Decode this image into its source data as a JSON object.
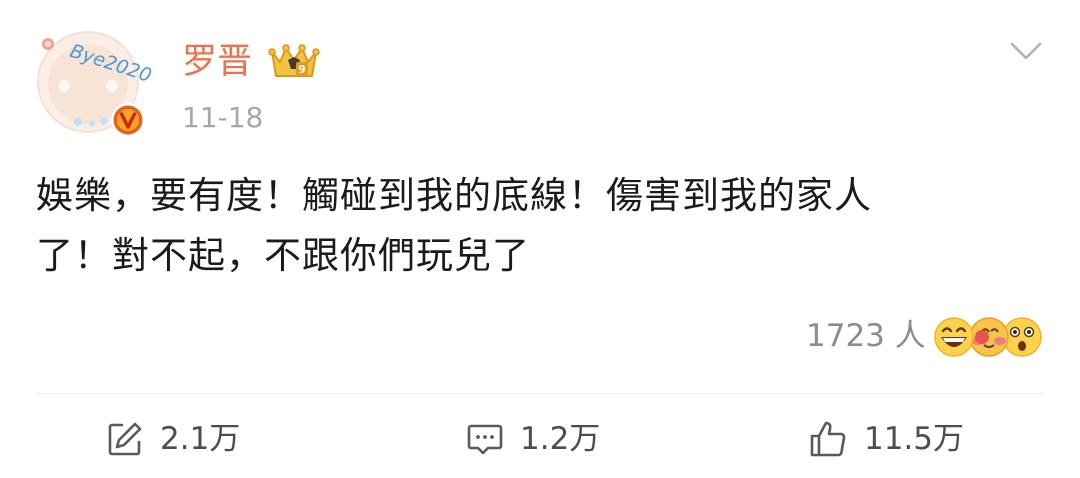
{
  "post": {
    "author": {
      "name": "罗晋",
      "avatar_badge": "Bye2020",
      "verified_icon": "verified-v-icon",
      "crown_icon": "crown-badge-icon"
    },
    "date": "11-18",
    "text_lines": [
      "娛樂，要有度！觸碰到我的底線！傷害到我的家人",
      "了！對不起，不跟你們玩兒了"
    ],
    "menu_icon": "chevron-down-icon",
    "reactions": {
      "count": "1723 人",
      "emoji_icons": [
        "laughing-emoji-icon",
        "cute-emoji-icon",
        "shocked-emoji-icon"
      ]
    }
  },
  "actions": {
    "repost": {
      "icon": "repost-icon",
      "count": "2.1万"
    },
    "comment": {
      "icon": "comment-icon",
      "count": "1.2万"
    },
    "like": {
      "icon": "like-icon",
      "count": "11.5万"
    }
  },
  "colors": {
    "username": "#eb7350",
    "secondary_text": "#a8a8a8",
    "body_text": "#1a1a1a",
    "action_text": "#4d4d4d",
    "verified_badge": "#e0621e"
  }
}
